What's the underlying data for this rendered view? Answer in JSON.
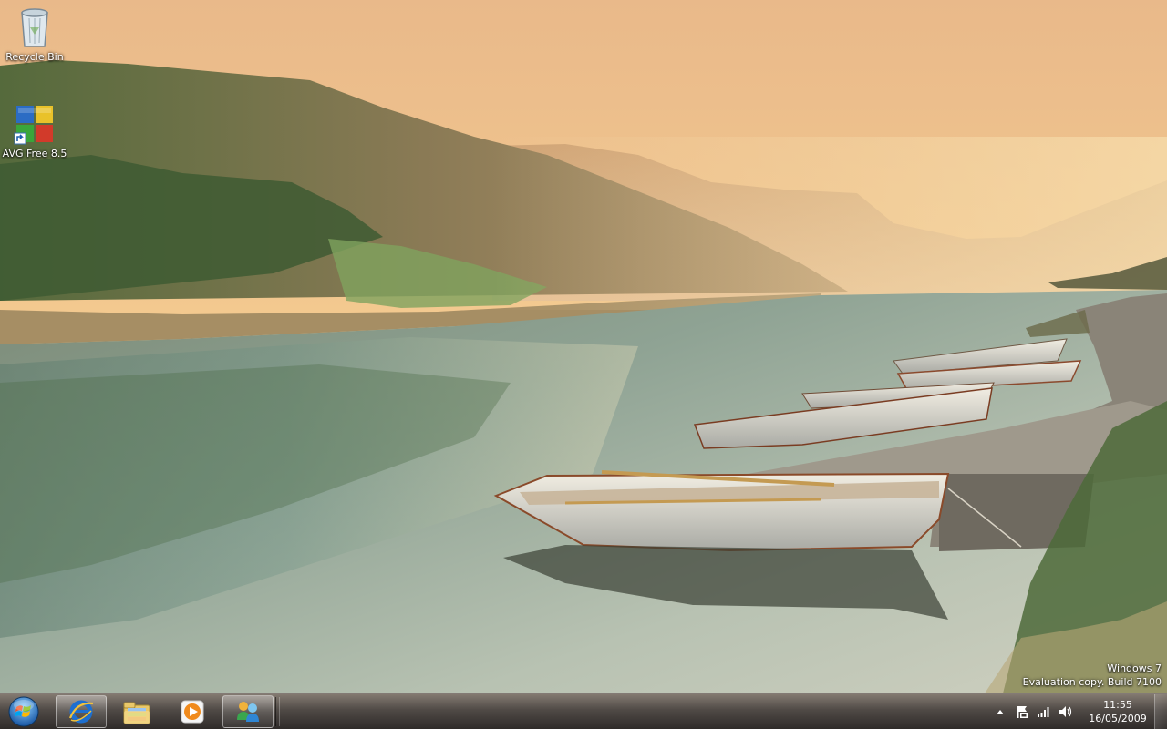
{
  "desktop": {
    "icons": [
      {
        "label": "Recycle Bin",
        "icon": "recycle-bin-icon"
      },
      {
        "label": "AVG Free 8.5",
        "icon": "avg-shield-icon"
      }
    ],
    "watermark": {
      "line1": "Windows 7",
      "line2": "Evaluation copy. Build 7100"
    }
  },
  "taskbar": {
    "start_icon": "windows-orb-icon",
    "pinned": [
      {
        "name": "Internet Explorer",
        "icon": "internet-explorer-icon",
        "active": true
      },
      {
        "name": "Windows Explorer",
        "icon": "folder-library-icon",
        "active": false
      },
      {
        "name": "Windows Media Player",
        "icon": "media-player-icon",
        "active": false
      },
      {
        "name": "Windows Live Messenger",
        "icon": "messenger-icon",
        "active": true
      }
    ],
    "tray": {
      "icons": [
        "show-hidden-icons-icon",
        "action-center-flag-icon",
        "network-signal-icon",
        "volume-icon"
      ],
      "time": "11:55",
      "date": "16/05/2009"
    }
  },
  "colors": {
    "sky_top": "#f2c98e",
    "sky_horizon": "#f7e2a8",
    "water": "#6f8f86",
    "taskbar": "#3c3734"
  }
}
